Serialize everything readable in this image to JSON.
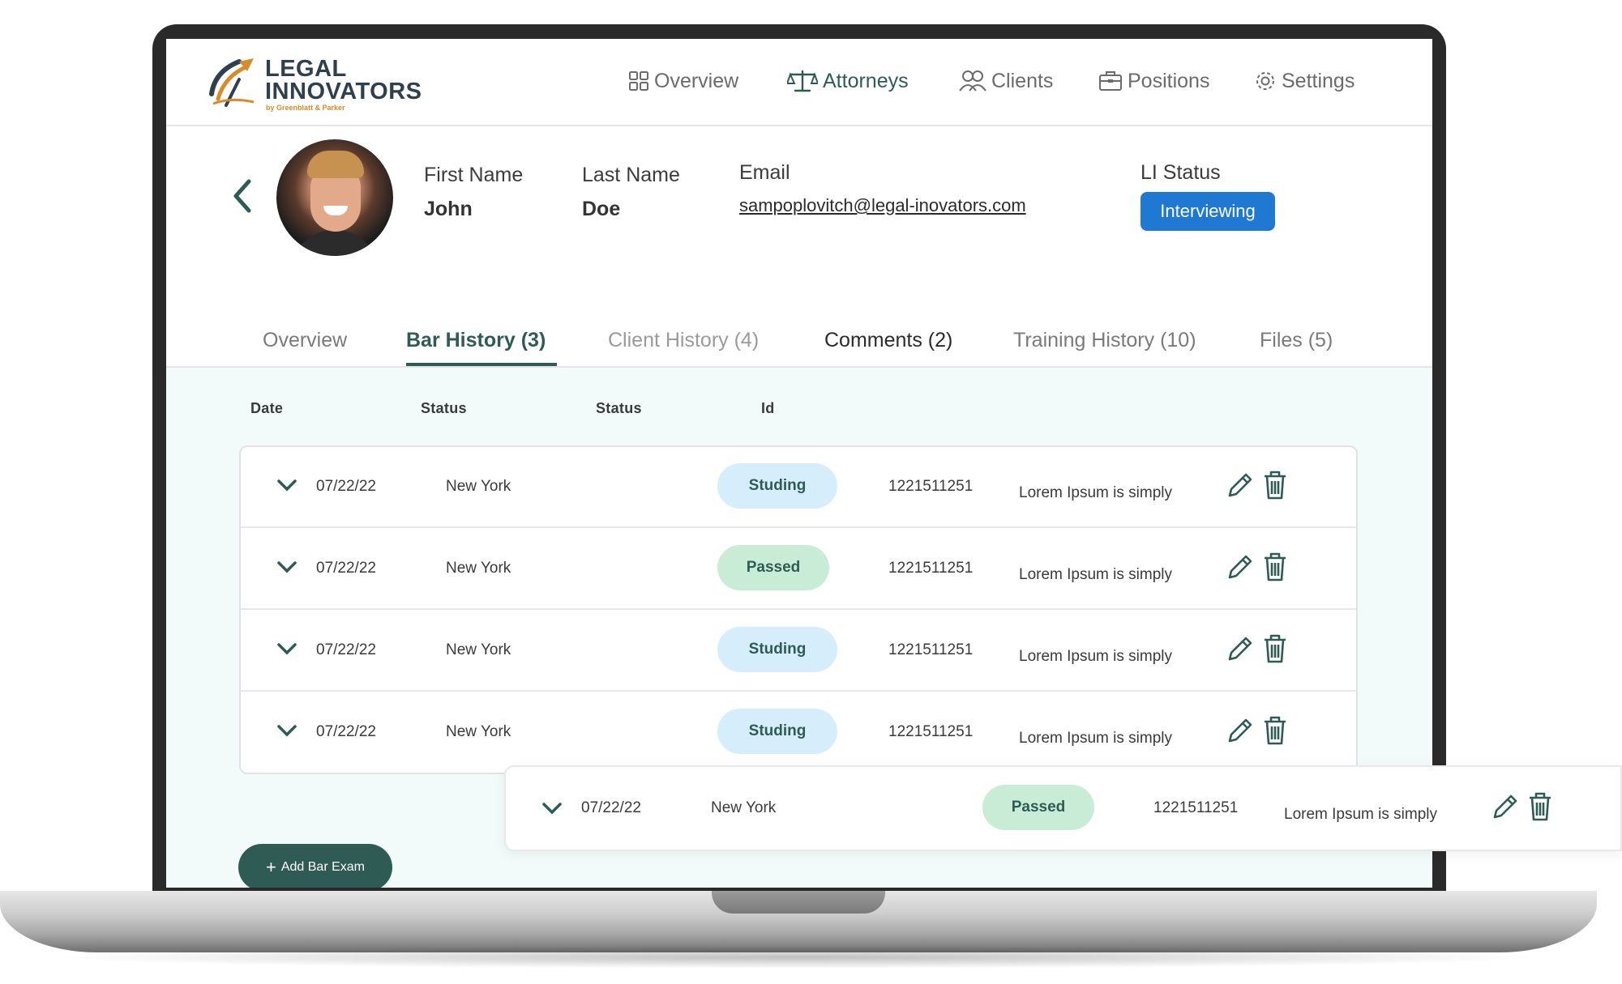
{
  "logo": {
    "line1": "LEGAL",
    "line2": "INNOVATORS",
    "sub": "by Greenblatt & Parker"
  },
  "nav": [
    {
      "label": "Overview",
      "icon": "grid-icon"
    },
    {
      "label": "Attorneys",
      "icon": "scales-icon"
    },
    {
      "label": "Clients",
      "icon": "users-icon"
    },
    {
      "label": "Positions",
      "icon": "briefcase-icon"
    },
    {
      "label": "Settings",
      "icon": "gear-icon"
    }
  ],
  "profile": {
    "first_name_label": "First Name",
    "first_name": "John",
    "last_name_label": "Last Name",
    "last_name": "Doe",
    "email_label": "Email",
    "email": "sampoplovitch@legal-inovators.com",
    "status_label": "LI Status",
    "status": "Interviewing"
  },
  "tabs": [
    {
      "label": "Overview"
    },
    {
      "label": "Bar History (3)"
    },
    {
      "label": "Client History (4)"
    },
    {
      "label": "Comments (2)"
    },
    {
      "label": "Training History (10)"
    },
    {
      "label": "Files (5)"
    }
  ],
  "table": {
    "headers": [
      "Date",
      "Status",
      "Status",
      "Id"
    ],
    "rows": [
      {
        "date": "07/22/22",
        "state": "New York",
        "status": "Studing",
        "id": "1221511251",
        "note": "Lorem Ipsum is simply"
      },
      {
        "date": "07/22/22",
        "state": "New York",
        "status": "Passed",
        "id": "1221511251",
        "note": "Lorem Ipsum is simply"
      },
      {
        "date": "07/22/22",
        "state": "New York",
        "status": "Studing",
        "id": "1221511251",
        "note": "Lorem Ipsum is simply"
      },
      {
        "date": "07/22/22",
        "state": "New York",
        "status": "Studing",
        "id": "1221511251",
        "note": "Lorem Ipsum is simply"
      }
    ],
    "floating_row": {
      "date": "07/22/22",
      "state": "New York",
      "status": "Passed",
      "id": "1221511251",
      "note": "Lorem Ipsum is simply"
    }
  },
  "add_button": {
    "label": "Add Bar Exam"
  },
  "colors": {
    "brand": "#2e5c55",
    "status_pill": "#1f78d1",
    "studing_bg": "#d6eefc",
    "passed_bg": "#c9ecd6",
    "content_bg": "#f2fbfa"
  }
}
